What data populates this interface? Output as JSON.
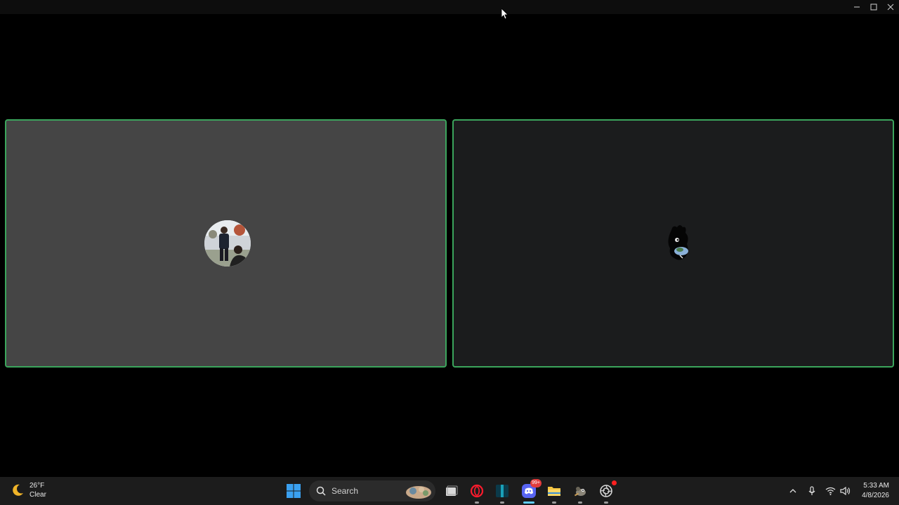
{
  "window": {
    "controls": [
      "minimize",
      "maximize",
      "close"
    ]
  },
  "call": {
    "participants": [
      {
        "avatar_icon": "avatar-photo",
        "speaking_color": "#3ba55c",
        "tile_bg": "#454545"
      },
      {
        "avatar_icon": "avatar-character",
        "speaking_color": "#3ba55c",
        "tile_bg": "#1b1c1d"
      }
    ]
  },
  "taskbar": {
    "weather": {
      "temp": "26°F",
      "condition": "Clear",
      "icon": "moon-icon"
    },
    "search": {
      "placeholder": "Search"
    },
    "apps": [
      {
        "name": "start",
        "icon": "windows-icon"
      },
      {
        "name": "task-view",
        "icon": "task-view-icon"
      },
      {
        "name": "opera",
        "icon": "opera-icon"
      },
      {
        "name": "app-teal",
        "icon": "teal-app-icon"
      },
      {
        "name": "discord",
        "icon": "discord-icon",
        "badge": "99+"
      },
      {
        "name": "file-explorer",
        "icon": "folder-icon"
      },
      {
        "name": "gimp",
        "icon": "gimp-icon"
      },
      {
        "name": "recording-app",
        "icon": "ring-icon"
      }
    ],
    "clock": {
      "time": "5:33 AM",
      "date": "4/8/2026"
    }
  }
}
